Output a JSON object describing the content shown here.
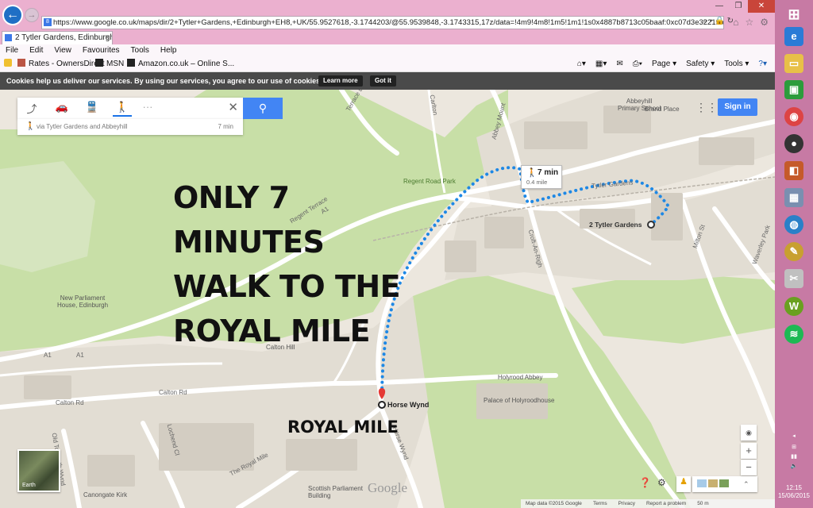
{
  "browser": {
    "url": "https://www.google.co.uk/maps/dir/2+Tytler+Gardens,+Edinburgh+EH8,+UK/55.9527618,-3.1744203/@55.9539848,-3.1743315,17z/data=!4m9!4m8!1m5!1m1!1s0x4887b8713c05baaf:0xc07d3e3221f2d256!2m2!1d-3.1",
    "tab_title": "2 Tytler Gardens, Edinburgh...",
    "menu": [
      "File",
      "Edit",
      "View",
      "Favourites",
      "Tools",
      "Help"
    ],
    "favorites": [
      "Rates - OwnersDirect",
      "MSN",
      "Amazon.co.uk – Online S..."
    ],
    "command_bar": [
      "Page ▾",
      "Safety ▾",
      "Tools ▾"
    ]
  },
  "cookie": {
    "message": "Cookies help us deliver our services. By using our services, you agree to our use of cookies.",
    "learn_more": "Learn more",
    "got_it": "Got it"
  },
  "search": {
    "route_via": "via Tytler Gardens and Abbeyhill",
    "route_duration": "7 min",
    "more": "···"
  },
  "header": {
    "sign_in": "Sign in"
  },
  "promo": {
    "lines": [
      "ONLY 7",
      "MINUTES",
      "WALK TO THE",
      "ROYAL MILE"
    ],
    "royal_mile": "ROYAL MILE"
  },
  "route": {
    "bubble_time": "7 min",
    "bubble_distance": "0.4 mile",
    "destination": "2 Tytler Gardens",
    "origin": "Horse Wynd"
  },
  "map_labels": {
    "abbeyhill_school": "Abbeyhill\nPrimary School",
    "brand_place": "Brand Place",
    "regent_road_park": "Regent Road Park",
    "new_parliament": "New Parliament\nHouse, Edinburgh",
    "calton_hill": "Calton Hill",
    "holyrood_abbey": "Holyrood Abbey",
    "palace": "Palace of Holyroodhouse",
    "scottish_parliament": "Scottish Parliament\nBuilding",
    "canongate_kirk": "Canongate Kirk",
    "regent_terrace": "Regent Terrace",
    "a1_a": "A1",
    "a1_b": "A1",
    "a1_c": "A1",
    "calton_rd_a": "Calton Rd",
    "calton_rd_b": "Calton Rd",
    "croft_an_righ": "Croft-An-Righ",
    "abbey_mount": "Abbey Mount",
    "milton_st": "Milton St",
    "waverley_park": "Waverley Park",
    "tytler_gardens": "Tytler Gardens",
    "royal_mile_street": "The Royal Mile",
    "horse_wynd_street": "Horse Wynd",
    "terrace_ln": "Terrace Ln",
    "lochend_cl": "Lochend Cl",
    "old_tolbooth": "Old Tolbooth Wynd",
    "carlton": "Carlton"
  },
  "controls": {
    "earth": "Earth",
    "google": "Google"
  },
  "footer": [
    "Map data ©2015 Google",
    "Terms",
    "Privacy",
    "Report a problem",
    "50 m"
  ],
  "taskbar": {
    "time": "12:15",
    "date": "15/06/2015"
  },
  "colors": {
    "route": "#1e88e5",
    "search_button": "#4285f4",
    "park": "#c8dfa7",
    "cookie_bar": "#4a4a4a"
  }
}
